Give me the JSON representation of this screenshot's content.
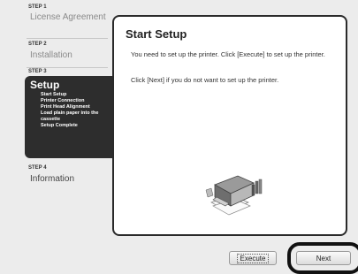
{
  "sidebar": {
    "step1": {
      "label": "STEP 1",
      "item": "License Agreement"
    },
    "step2": {
      "label": "STEP 2",
      "item": "Installation"
    },
    "step3": {
      "label": "STEP 3",
      "title": "Setup",
      "subitems": [
        "Start Setup",
        "Printer Connection",
        "Print Head Alignment",
        "Load plain paper into the cassette",
        "Setup Complete"
      ]
    },
    "step4": {
      "label": "STEP 4",
      "item": "Information"
    }
  },
  "main": {
    "title": "Start Setup",
    "paragraph1": "You need to set up the printer. Click [Execute] to set up the printer.",
    "paragraph2": "Click [Next] if you do not want to set up the printer.",
    "illustration_icon": "printer-icon"
  },
  "buttons": {
    "execute": "Execute",
    "next": "Next"
  }
}
